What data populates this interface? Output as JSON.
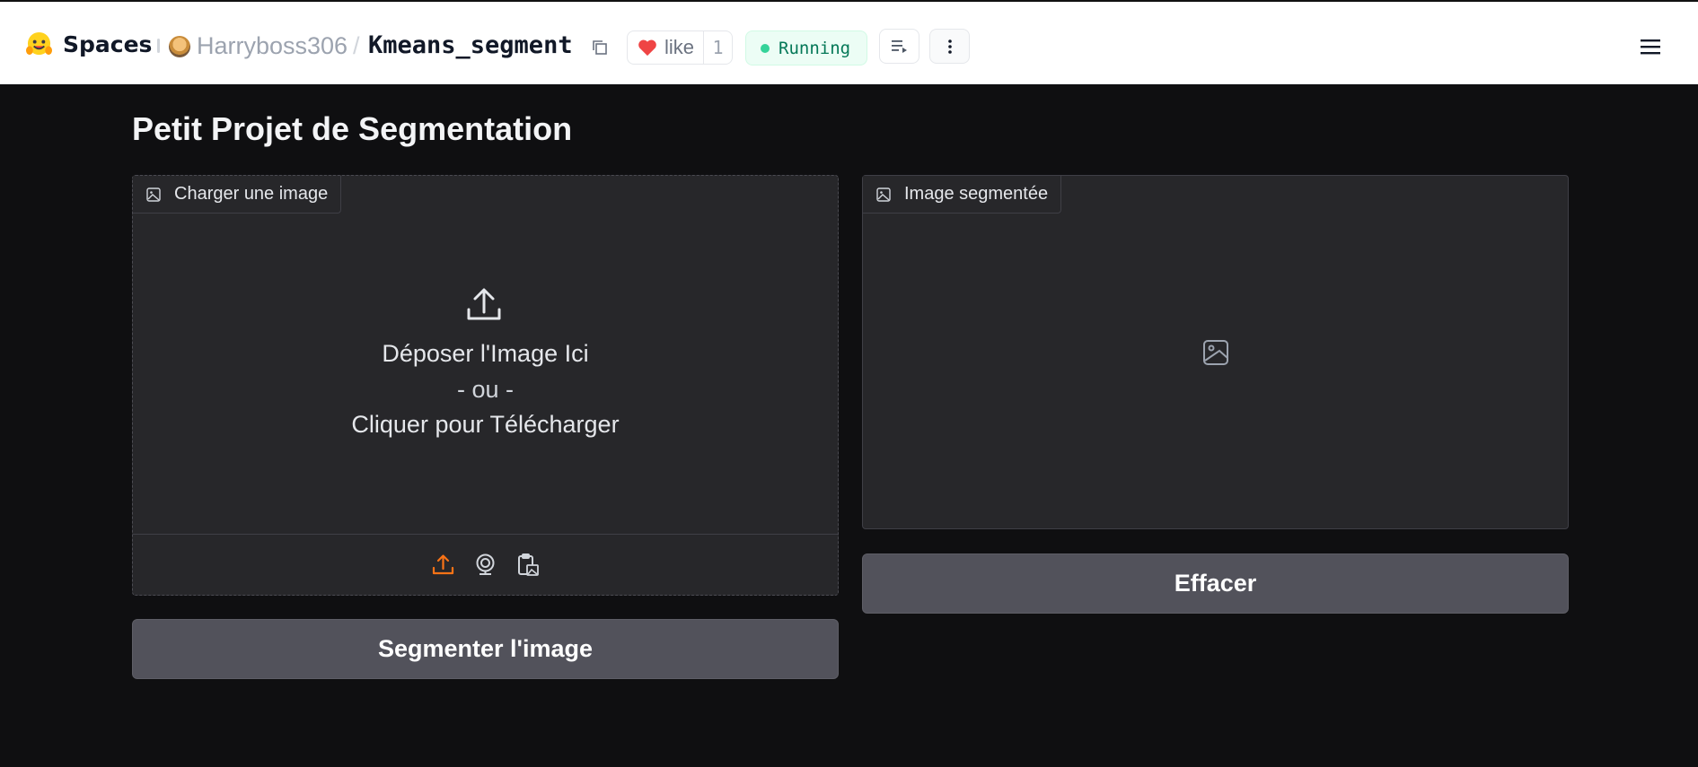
{
  "header": {
    "spaces_label": "Spaces",
    "owner": "Harryboss306",
    "separator": "/",
    "repo": "Kmeans_segment",
    "like_label": "like",
    "like_count": "1",
    "status": "Running",
    "status_color": "#34d399"
  },
  "main": {
    "title": "Petit Projet de Segmentation",
    "upload_panel": {
      "label": "Charger une image",
      "drop_line1": "Déposer l'Image Ici",
      "drop_line2": "- ou -",
      "drop_line3": "Cliquer pour Télécharger",
      "sources": [
        "upload-icon",
        "webcam-icon",
        "clipboard-icon"
      ]
    },
    "result_panel": {
      "label": "Image segmentée"
    },
    "segment_button": "Segmenter l'image",
    "clear_button": "Effacer"
  },
  "colors": {
    "accent": "#f97316",
    "background": "#0f0f11",
    "panel": "#27272a",
    "button": "#52525b"
  }
}
